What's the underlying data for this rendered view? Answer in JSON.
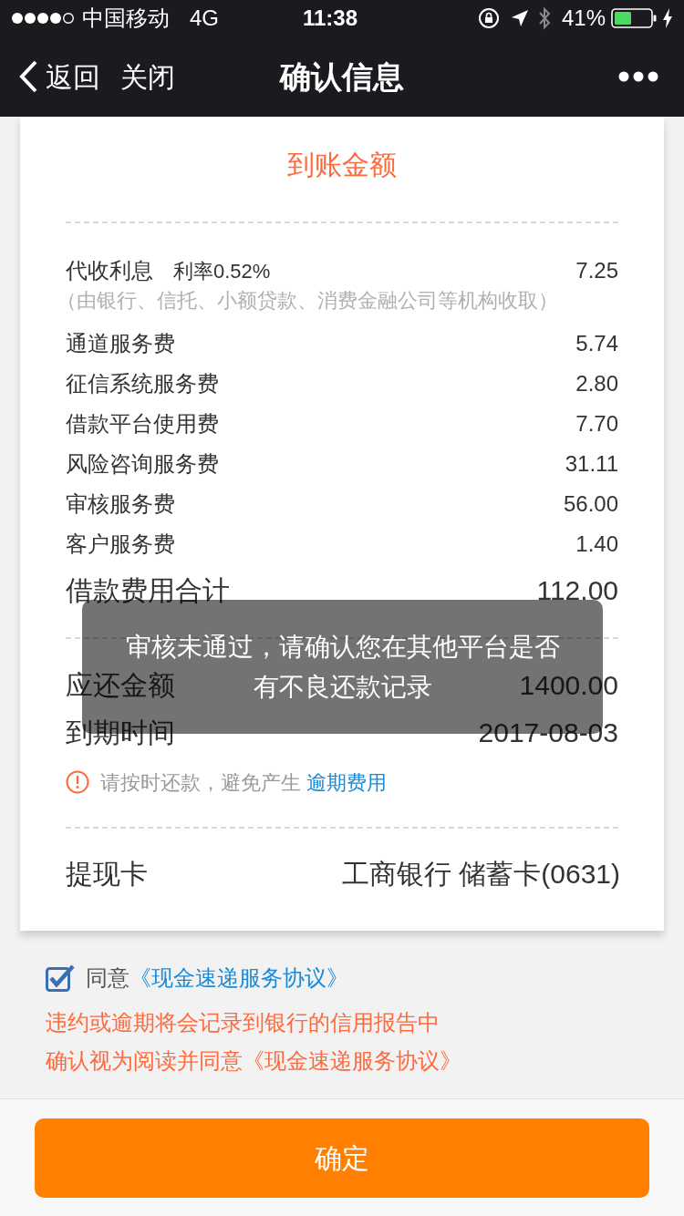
{
  "status_bar": {
    "carrier": "中国移动",
    "network": "4G",
    "time": "11:38",
    "battery": "41%"
  },
  "nav": {
    "back": "返回",
    "close": "关闭",
    "title": "确认信息"
  },
  "amount_label": "到账金额",
  "fees": [
    {
      "label": "代收利息",
      "rate": "利率0.52%",
      "value": "7.25",
      "note": "（由银行、信托、小额贷款、消费金融公司等机构收取）"
    },
    {
      "label": "通道服务费",
      "value": "5.74"
    },
    {
      "label": "征信系统服务费",
      "value": "2.80"
    },
    {
      "label": "借款平台使用费",
      "value": "7.70"
    },
    {
      "label": "风险咨询服务费",
      "value": "31.11"
    },
    {
      "label": "审核服务费",
      "value": "56.00"
    },
    {
      "label": "客户服务费",
      "value": "1.40"
    }
  ],
  "total": {
    "label": "借款费用合计",
    "value": "112.00"
  },
  "repay": [
    {
      "label": "应还金额",
      "value": "1400.00"
    },
    {
      "label": "到期时间",
      "value": "2017-08-03"
    }
  ],
  "reminder": {
    "text": "请按时还款，避免产生",
    "link": "逾期费用"
  },
  "withdraw_card": {
    "label": "提现卡",
    "value": "工商银行 储蓄卡(0631)"
  },
  "agreement": {
    "checked": true,
    "text": "同意",
    "link": "《现金速递服务协议》"
  },
  "warnings": [
    "违约或逾期将会记录到银行的信用报告中",
    "确认视为阅读并同意《现金速递服务协议》"
  ],
  "confirm_button": "确定",
  "toast": "审核未通过，请确认您在其他平台是否有不良还款记录"
}
